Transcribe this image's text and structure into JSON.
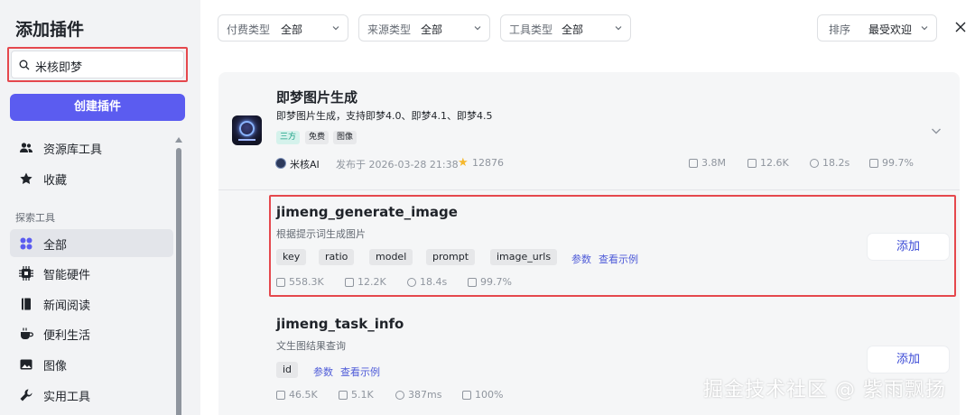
{
  "sidebar": {
    "title": "添加插件",
    "search_value": "米核即梦",
    "create_button": "创建插件",
    "top_items": [
      {
        "label": "资源库工具",
        "icon": "users-icon"
      },
      {
        "label": "收藏",
        "icon": "star-icon"
      }
    ],
    "section_label": "探索工具",
    "items": [
      {
        "label": "全部",
        "icon": "grid-icon",
        "active": true
      },
      {
        "label": "智能硬件",
        "icon": "chip-icon"
      },
      {
        "label": "新闻阅读",
        "icon": "book-icon"
      },
      {
        "label": "便利生活",
        "icon": "cup-icon"
      },
      {
        "label": "图像",
        "icon": "image-icon"
      },
      {
        "label": "实用工具",
        "icon": "wrench-icon"
      }
    ]
  },
  "filters": [
    {
      "label": "付费类型",
      "value": "全部"
    },
    {
      "label": "来源类型",
      "value": "全部"
    },
    {
      "label": "工具类型",
      "value": "全部"
    }
  ],
  "sort": {
    "label": "排序",
    "value": "最受欢迎"
  },
  "plugin": {
    "name": "即梦图片生成",
    "description": "即梦图片生成，支持即梦4.0、即梦4.1、即梦4.5",
    "tags": [
      "三方",
      "免费",
      "图像"
    ],
    "author": "米核AI",
    "published": "发布于 2026-03-28 21:38",
    "stars": "12876",
    "stats": [
      "3.8M",
      "12.6K",
      "18.2s",
      "99.7%"
    ]
  },
  "tools": [
    {
      "name": "jimeng_generate_image",
      "description": "根据提示词生成图片",
      "params": [
        "key",
        "ratio",
        "model",
        "prompt",
        "image_urls"
      ],
      "params_link": "参数",
      "example_link": "查看示例",
      "add_label": "添加",
      "stats": [
        "558.3K",
        "12.2K",
        "18.4s",
        "99.7%"
      ]
    },
    {
      "name": "jimeng_task_info",
      "description": "文生图结果查询",
      "params": [
        "id"
      ],
      "params_link": "参数",
      "example_link": "查看示例",
      "add_label": "添加",
      "stats": [
        "46.5K",
        "5.1K",
        "387ms",
        "100%"
      ]
    }
  ],
  "watermark": "掘金技术社区 @ 紫雨飘扬",
  "colors": {
    "accent": "#5b5cf0",
    "highlight": "#e5484d",
    "link": "#4e5bd8"
  }
}
